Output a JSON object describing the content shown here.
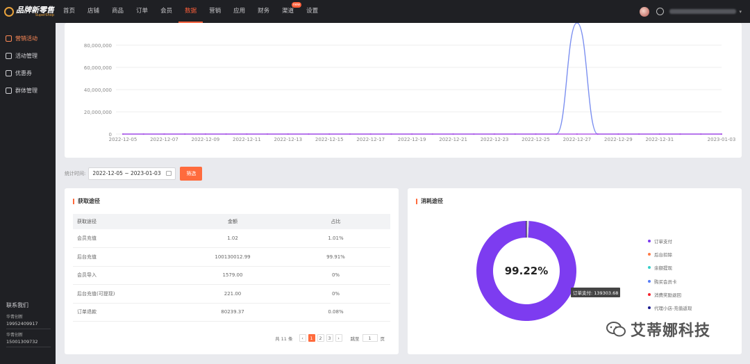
{
  "brand": {
    "name": "品牌新零售",
    "sub": "SuperShop"
  },
  "nav": [
    {
      "label": "首页"
    },
    {
      "label": "店铺"
    },
    {
      "label": "商品"
    },
    {
      "label": "订单"
    },
    {
      "label": "会员"
    },
    {
      "label": "数据",
      "active": true
    },
    {
      "label": "营销"
    },
    {
      "label": "应用"
    },
    {
      "label": "财务"
    },
    {
      "label": "渠道",
      "badge": "new"
    },
    {
      "label": "设置"
    }
  ],
  "sidebar": {
    "items": [
      {
        "label": "营销活动",
        "icon": "tag-icon"
      },
      {
        "label": "活动管理",
        "icon": "calendar-icon"
      },
      {
        "label": "优惠券",
        "icon": "coupon-icon"
      },
      {
        "label": "群体管理",
        "icon": "group-icon"
      }
    ],
    "contact": {
      "title": "联系我们",
      "entries": [
        {
          "name": "华青创新",
          "phone": "19952409917"
        },
        {
          "name": "华青创新",
          "phone": "15001309732"
        }
      ]
    }
  },
  "chart_data": {
    "type": "line",
    "x": [
      "2022-12-05",
      "2022-12-06",
      "2022-12-07",
      "2022-12-08",
      "2022-12-09",
      "2022-12-10",
      "2022-12-11",
      "2022-12-12",
      "2022-12-13",
      "2022-12-14",
      "2022-12-15",
      "2022-12-16",
      "2022-12-17",
      "2022-12-18",
      "2022-12-19",
      "2022-12-20",
      "2022-12-21",
      "2022-12-22",
      "2022-12-23",
      "2022-12-24",
      "2022-12-25",
      "2022-12-26",
      "2022-12-27",
      "2022-12-28",
      "2022-12-29",
      "2022-12-30",
      "2022-12-31",
      "2023-01-01",
      "2023-01-02",
      "2023-01-03"
    ],
    "x_ticks": [
      "2022-12-05",
      "2022-12-07",
      "2022-12-09",
      "2022-12-11",
      "2022-12-13",
      "2022-12-15",
      "2022-12-17",
      "2022-12-19",
      "2022-12-21",
      "2022-12-23",
      "2022-12-25",
      "2022-12-27",
      "2022-12-29",
      "2022-12-31",
      "2023-01-03"
    ],
    "y_ticks": [
      "0",
      "20,000,000",
      "40,000,000",
      "60,000,000",
      "80,000,000"
    ],
    "ylim": [
      0,
      100000000
    ],
    "series": [
      {
        "color": "#7b8ff0",
        "values": [
          0,
          0,
          0,
          0,
          0,
          0,
          0,
          0,
          0,
          0,
          0,
          0,
          0,
          0,
          0,
          0,
          0,
          0,
          0,
          0,
          0,
          0,
          100130012.99,
          0,
          0,
          0,
          0,
          0,
          0,
          0
        ]
      },
      {
        "color": "#b35ce8",
        "values": [
          0,
          0,
          0,
          0,
          0,
          0,
          0,
          0,
          0,
          0,
          0,
          0,
          0,
          0,
          0,
          0,
          0,
          0,
          0,
          0,
          0,
          0,
          0,
          0,
          0,
          0,
          0,
          0,
          0,
          0
        ]
      }
    ]
  },
  "filter": {
    "label": "统计时间:",
    "range": "2022-12-05 ~ 2023-01-03",
    "button": "筛选"
  },
  "acquire": {
    "title": "获取途径",
    "headers": [
      "获取途径",
      "金额",
      "占比"
    ],
    "rows": [
      [
        "会员充值",
        "1.02",
        "1.01%"
      ],
      [
        "后台充值",
        "100130012.99",
        "99.91%"
      ],
      [
        "会员导入",
        "1579.00",
        "0%"
      ],
      [
        "后台充值(可提现)",
        "221.00",
        "0%"
      ],
      [
        "订单退款",
        "80239.37",
        "0.08%"
      ]
    ],
    "pager": {
      "total": "共 11 条",
      "pages": [
        "1",
        "2",
        "3"
      ],
      "prev": "‹",
      "next": "›",
      "jump": "跳至",
      "jump_value": "1",
      "unit": "页"
    }
  },
  "consume": {
    "title": "消耗途径",
    "center": "99.22%",
    "tooltip": "订单支付: 139303.68",
    "slices": [
      {
        "value": 99.22,
        "color": "#7d3cf0"
      },
      {
        "value": 0.78,
        "color": "#e0e0e8"
      }
    ],
    "legend": [
      {
        "label": "订单支付",
        "color": "#7d3cf0"
      },
      {
        "label": "后台扣除",
        "color": "#ff7a45"
      },
      {
        "label": "余额提现",
        "color": "#36cfc9"
      },
      {
        "label": "购买会员卡",
        "color": "#597ef7"
      },
      {
        "label": "消费奖励退回",
        "color": "#f5222d"
      },
      {
        "label": "代理小店-充值返现",
        "color": "#1d1d8f"
      }
    ]
  },
  "watermark": "艾蒂娜科技"
}
